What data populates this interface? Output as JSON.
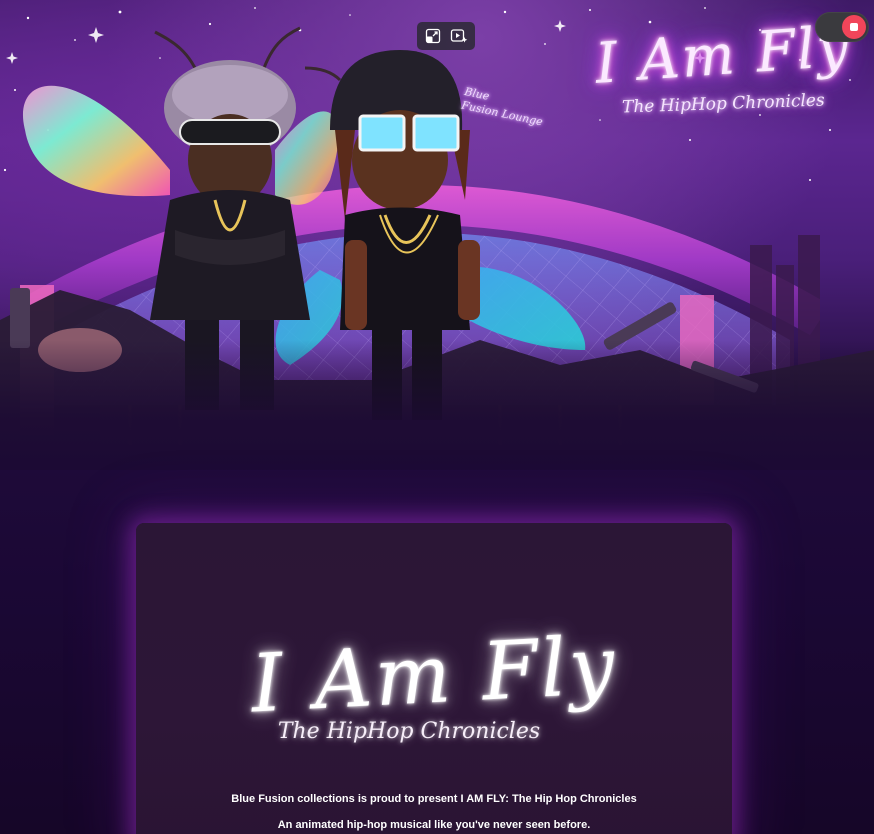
{
  "hero": {
    "neon_title": "I Am Fly",
    "neon_subtitle": "The HipHop Chronicles",
    "lounge_sign_line1": "Blue",
    "lounge_sign_line2": "Fusion Lounge"
  },
  "toolbar": {
    "icons": [
      "exit-fullscreen-icon",
      "video-sparkle-icon"
    ]
  },
  "record": {
    "state": "recording",
    "color": "#f1455a"
  },
  "card": {
    "logo_main": "I Am Fly",
    "logo_sub": "The HipHop Chronicles",
    "tagline": "Blue Fusion collections is proud to present I AM FLY: The Hip Hop Chronicles",
    "description": "An animated hip-hop musical like you've never seen before."
  },
  "colors": {
    "background": "#1c0a34",
    "card_glow": "#b034d6",
    "neon_pink": "#ff66d9",
    "neon_purple": "#c04dff"
  }
}
